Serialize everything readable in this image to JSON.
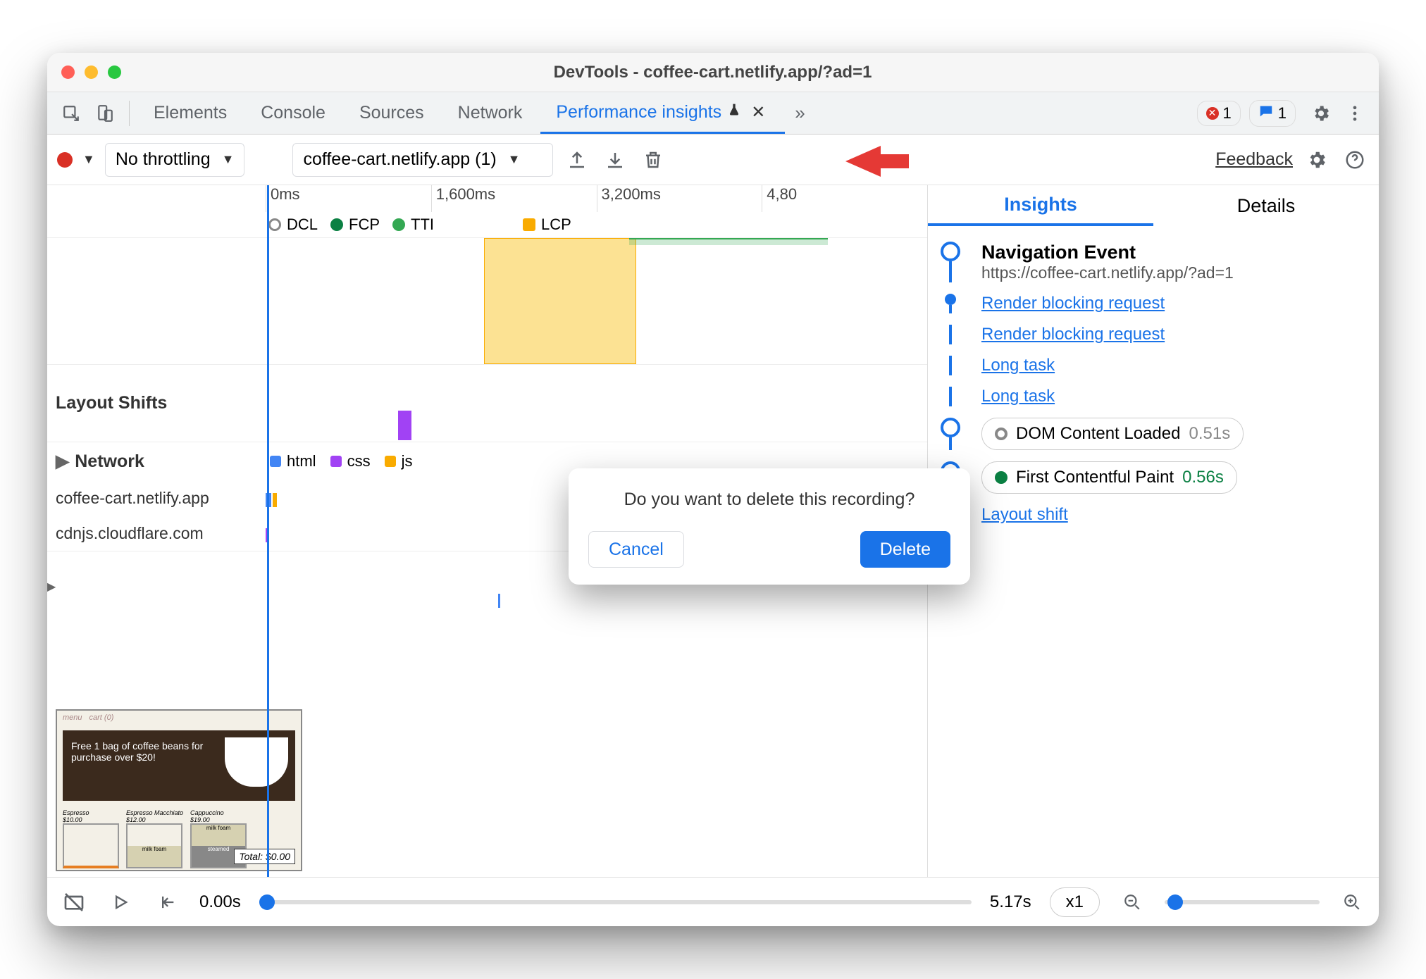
{
  "titlebar": {
    "title": "DevTools - coffee-cart.netlify.app/?ad=1"
  },
  "tabs": {
    "elements": "Elements",
    "console": "Console",
    "sources": "Sources",
    "network": "Network",
    "perf": "Performance insights",
    "error_count": "1",
    "msg_count": "1"
  },
  "toolbar": {
    "throttle": "No throttling",
    "recording": "coffee-cart.netlify.app (1)",
    "feedback": "Feedback"
  },
  "ruler": {
    "t0": "0ms",
    "t1": "1,600ms",
    "t2": "3,200ms",
    "t3": "4,80"
  },
  "markers": {
    "dcl": "DCL",
    "fcp": "FCP",
    "tti": "TTI",
    "lcp": "LCP"
  },
  "lanes": {
    "layout_shifts": "Layout Shifts",
    "network": "Network",
    "html": "html",
    "css": "css",
    "js": "js",
    "host1": "coffee-cart.netlify.app",
    "host2": "cdnjs.cloudflare.com"
  },
  "thumb": {
    "promo": "Free 1 bag of coffee beans for purchase over $20!",
    "p1": "Espresso",
    "p1p": "$10.00",
    "p2": "Espresso Macchiato",
    "p2p": "$12.00",
    "p3": "Cappuccino",
    "p3p": "$19.00",
    "foam": "milk foam",
    "steamed": "steamed",
    "total": "Total: $0.00",
    "nav_menu": "menu",
    "nav_cart": "cart (0)"
  },
  "right": {
    "insights": "Insights",
    "details": "Details",
    "nav_title": "Navigation Event",
    "nav_url": "https://coffee-cart.netlify.app/?ad=1",
    "rb1": "Render blocking request",
    "rb2": "Render blocking request",
    "lt1": "Long task",
    "lt2": "Long task",
    "dcl_label": "DOM Content Loaded",
    "dcl_time": "0.51s",
    "fcp_label": "First Contentful Paint",
    "fcp_time": "0.56s",
    "ls": "Layout shift"
  },
  "footer": {
    "start": "0.00s",
    "end": "5.17s",
    "speed": "x1"
  },
  "dialog": {
    "msg": "Do you want to delete this recording?",
    "cancel": "Cancel",
    "delete": "Delete"
  }
}
